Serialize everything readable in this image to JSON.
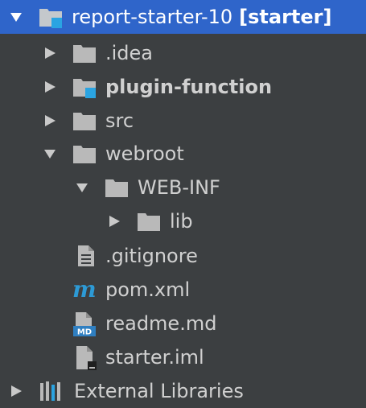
{
  "tree": {
    "root": {
      "label": "report-starter-10",
      "tag": "[starter]"
    },
    "items": [
      {
        "label": ".idea"
      },
      {
        "label": "plugin-function"
      },
      {
        "label": "src"
      },
      {
        "label": "webroot"
      },
      {
        "label": "WEB-INF"
      },
      {
        "label": "lib"
      },
      {
        "label": ".gitignore"
      },
      {
        "label": "pom.xml"
      },
      {
        "label": "readme.md"
      },
      {
        "label": "starter.iml"
      },
      {
        "label": "External Libraries"
      }
    ],
    "icons": {
      "maven": "m",
      "markdown": "MD"
    }
  },
  "colors": {
    "background": "#3c3f41",
    "selection": "#2f65ca",
    "text": "#d0d0d0",
    "folder": "#b9b9b9",
    "module": "#2aa4e2",
    "maven": "#2d9ad5"
  }
}
